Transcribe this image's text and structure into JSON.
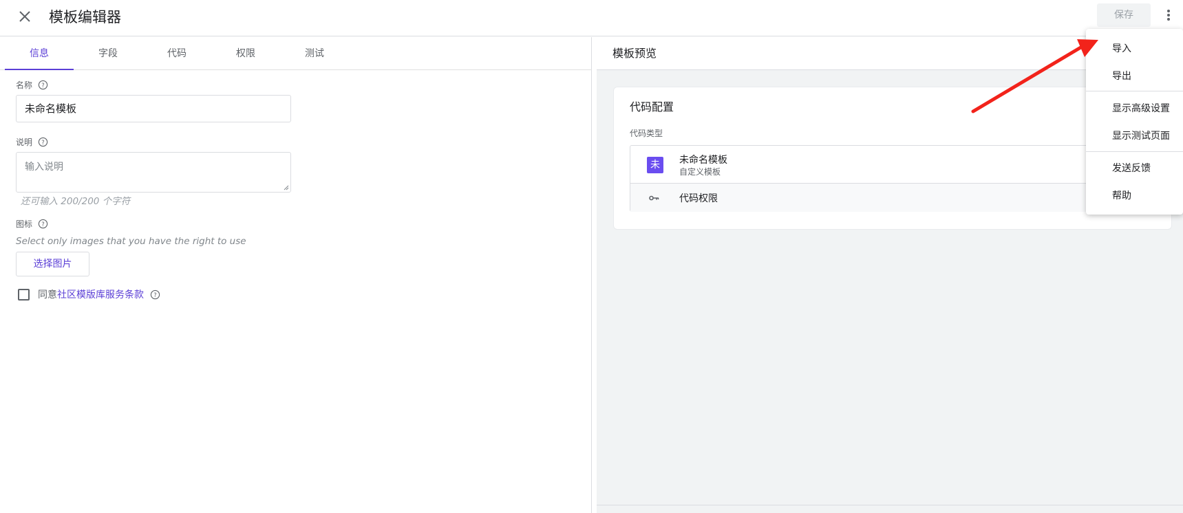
{
  "header": {
    "title": "模板编辑器",
    "save_label": "保存"
  },
  "tabs": [
    {
      "label": "信息",
      "active": true
    },
    {
      "label": "字段"
    },
    {
      "label": "代码"
    },
    {
      "label": "权限"
    },
    {
      "label": "测试"
    }
  ],
  "form": {
    "name_label": "名称",
    "name_value": "未命名模板",
    "desc_label": "说明",
    "desc_placeholder": "输入说明",
    "char_hint": "还可输入 200/200 个字符",
    "icon_label": "图标",
    "icon_note": "Select only images that you have the right to use",
    "choose_image_label": "选择图片",
    "agree_prefix": "同意",
    "agree_link": "社区模版库服务条款"
  },
  "preview": {
    "header": "模板预览",
    "card_title": "代码配置",
    "card_subtitle": "代码类型",
    "template_icon_char": "未",
    "template_name": "未命名模板",
    "template_type": "自定义模板",
    "permission_label": "代码权限"
  },
  "menu": {
    "items": [
      {
        "label": "导入"
      },
      {
        "label": "导出"
      },
      {
        "label": "显示高级设置"
      },
      {
        "label": "显示测试页面"
      },
      {
        "label": "发送反馈"
      },
      {
        "label": "帮助"
      }
    ]
  },
  "colors": {
    "accent": "#5b3fd6",
    "template_icon_bg": "#6a4df0",
    "annotation_arrow": "#f2231b"
  }
}
